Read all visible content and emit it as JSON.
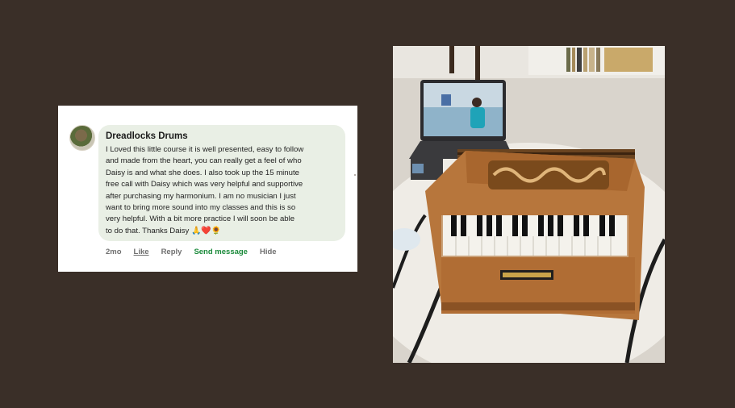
{
  "comment": {
    "author": "Dreadlocks Drums",
    "text": "I Loved this little course it is well presented, easy to follow\nand made from the heart, you can really get a feel of who\nDaisy is and what she does. I also took up the 15 minute\nfree call with Daisy which was very helpful and supportive\nafter purchasing my harmonium. I am no musician I just\nwant to bring more sound into my classes and this is so\nvery helpful. With a bit more practice I will soon be able\nto do that. Thanks Daisy",
    "emojis": "🙏❤️🌻",
    "actions": {
      "time": "2mo",
      "like": "Like",
      "reply": "Reply",
      "send_message": "Send message",
      "hide": "Hide"
    }
  },
  "colors": {
    "background": "#3a2f28",
    "bubble": "#e9efe5",
    "send_message": "#1a8a3a"
  },
  "photo": {
    "subject": "harmonium-with-laptop-photo"
  }
}
